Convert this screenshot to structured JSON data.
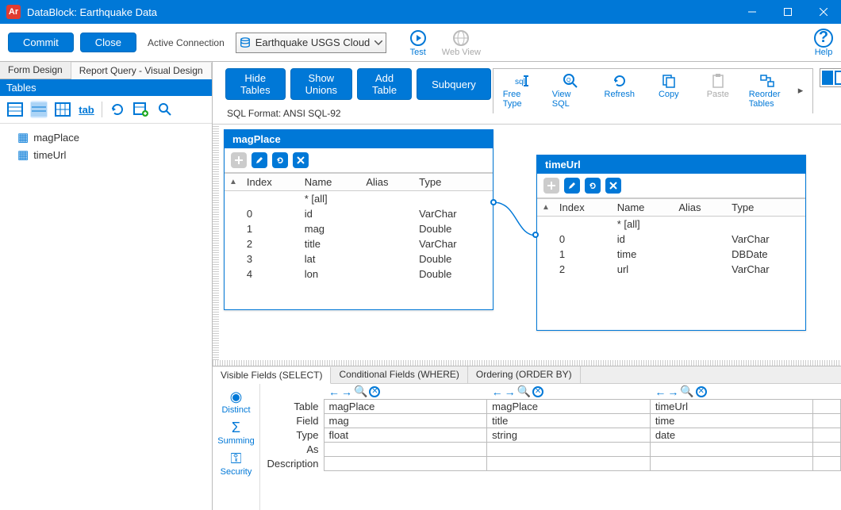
{
  "window": {
    "title": "DataBlock: Earthquake Data"
  },
  "toolbar": {
    "commit": "Commit",
    "close": "Close",
    "active_connection_label": "Active Connection",
    "connection_value": "Earthquake USGS Cloud Conn",
    "test": "Test",
    "web_view": "Web View",
    "help": "Help"
  },
  "left_tabs": {
    "form_design": "Form Design",
    "report_query": "Report Query - Visual Design"
  },
  "tables_panel": {
    "header": "Tables",
    "items": [
      {
        "name": "magPlace"
      },
      {
        "name": "timeUrl"
      }
    ]
  },
  "designer": {
    "buttons": {
      "hide_tables": "Hide Tables",
      "show_unions": "Show Unions",
      "add_table": "Add Table",
      "subquery": "Subquery"
    },
    "sql_format": "SQL Format: ANSI SQL-92",
    "actions": {
      "free_type": "Free Type",
      "view_sql": "View SQL",
      "refresh": "Refresh",
      "copy": "Copy",
      "paste": "Paste",
      "reorder": "Reorder Tables"
    }
  },
  "cards": {
    "magPlace": {
      "title": "magPlace",
      "headers": {
        "index": "Index",
        "name": "Name",
        "alias": "Alias",
        "type": "Type"
      },
      "all_row": "* [all]",
      "rows": [
        {
          "index": "0",
          "name": "id",
          "alias": "",
          "type": "VarChar"
        },
        {
          "index": "1",
          "name": "mag",
          "alias": "",
          "type": "Double"
        },
        {
          "index": "2",
          "name": "title",
          "alias": "",
          "type": "VarChar"
        },
        {
          "index": "3",
          "name": "lat",
          "alias": "",
          "type": "Double"
        },
        {
          "index": "4",
          "name": "lon",
          "alias": "",
          "type": "Double"
        }
      ]
    },
    "timeUrl": {
      "title": "timeUrl",
      "headers": {
        "index": "Index",
        "name": "Name",
        "alias": "Alias",
        "type": "Type"
      },
      "all_row": "* [all]",
      "rows": [
        {
          "index": "0",
          "name": "id",
          "alias": "",
          "type": "VarChar"
        },
        {
          "index": "1",
          "name": "time",
          "alias": "",
          "type": "DBDate"
        },
        {
          "index": "2",
          "name": "url",
          "alias": "",
          "type": "VarChar"
        }
      ]
    }
  },
  "lower_tabs": {
    "visible": "Visible Fields (SELECT)",
    "conditional": "Conditional Fields (WHERE)",
    "ordering": "Ordering (ORDER BY)"
  },
  "lower_side": {
    "distinct": "Distinct",
    "summing": "Summing",
    "security": "Security"
  },
  "lower_grid": {
    "row_labels": {
      "table": "Table",
      "field": "Field",
      "type": "Type",
      "as": "As",
      "description": "Description"
    },
    "cols": [
      {
        "table": "magPlace",
        "field": "mag",
        "type": "float",
        "as": "",
        "description": ""
      },
      {
        "table": "magPlace",
        "field": "title",
        "type": "string",
        "as": "",
        "description": ""
      },
      {
        "table": "timeUrl",
        "field": "time",
        "type": "date",
        "as": "",
        "description": ""
      },
      {
        "table": "",
        "field": "",
        "type": "",
        "as": "",
        "description": ""
      }
    ]
  }
}
